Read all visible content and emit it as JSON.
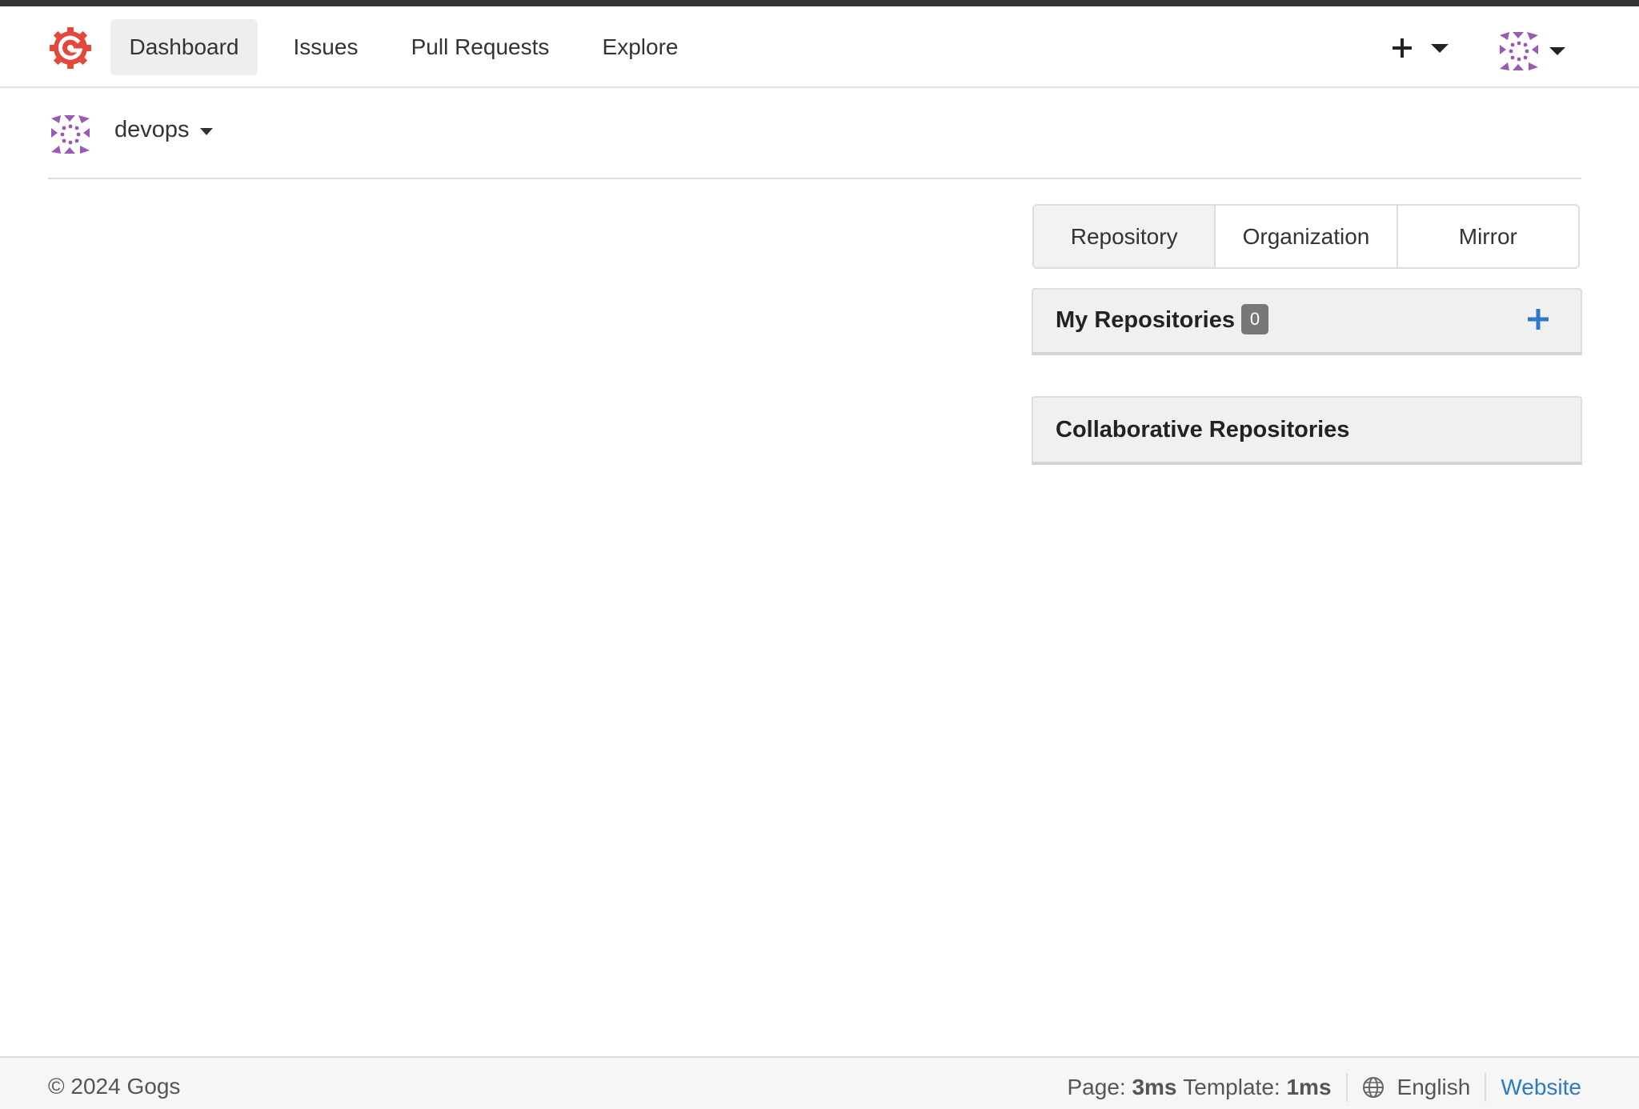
{
  "navbar": {
    "logo": "gogs-logo",
    "items": [
      {
        "label": "Dashboard",
        "active": true
      },
      {
        "label": "Issues",
        "active": false
      },
      {
        "label": "Pull Requests",
        "active": false
      },
      {
        "label": "Explore",
        "active": false
      }
    ],
    "create_menu_icon": "plus-icon",
    "user_menu_icon": "avatar"
  },
  "context": {
    "username": "devops"
  },
  "repo_tabs": [
    {
      "label": "Repository"
    },
    {
      "label": "Organization"
    },
    {
      "label": "Mirror"
    }
  ],
  "my_repos": {
    "title": "My Repositories",
    "count": "0"
  },
  "collab_repos": {
    "title": "Collaborative Repositories"
  },
  "footer": {
    "copyright": "© 2024 Gogs",
    "page_label": "Page:",
    "page_time": "3ms",
    "template_label": "Template:",
    "template_time": "1ms",
    "language": "English",
    "website": "Website"
  },
  "colors": {
    "logo": "#e2493b",
    "avatar": "#9b59b6",
    "accent_link": "#2a7ac7",
    "badge": "#777777"
  }
}
